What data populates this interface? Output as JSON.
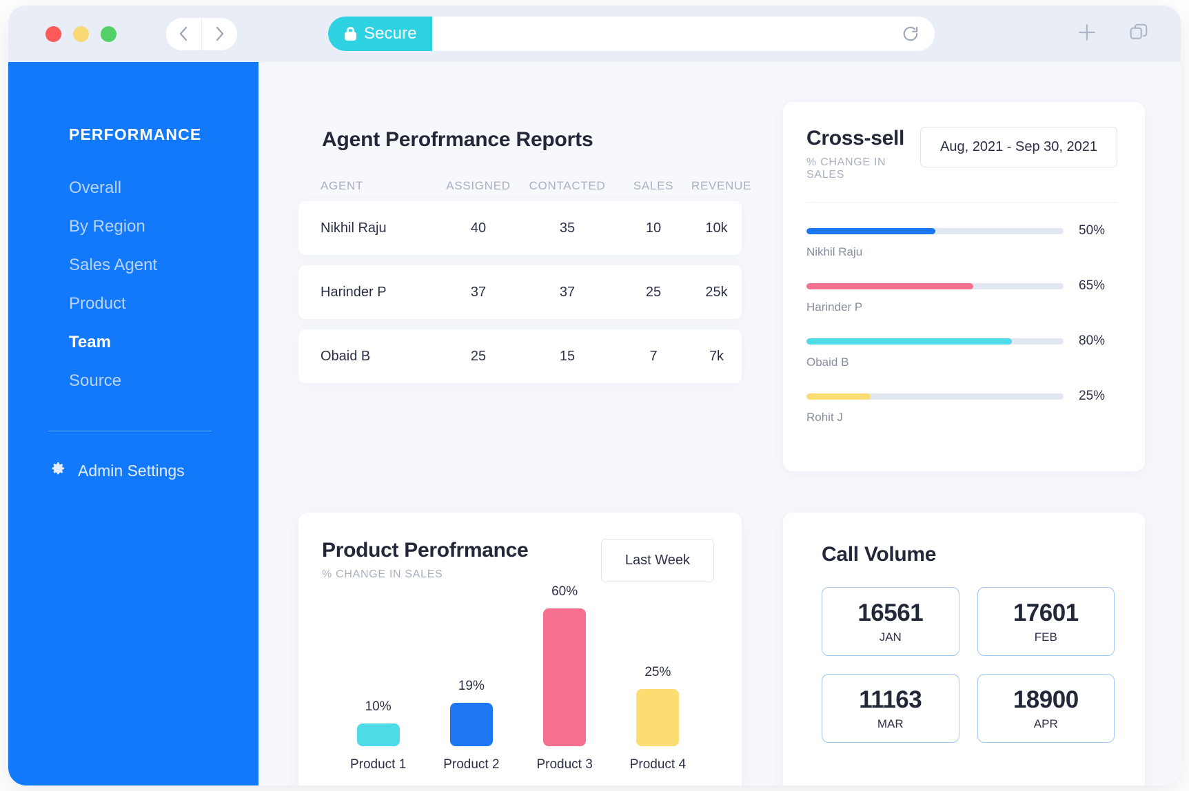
{
  "browser": {
    "secure_label": "Secure",
    "url_value": "",
    "url_placeholder": "",
    "back_icon": "chevron-left-icon",
    "forward_icon": "chevron-right-icon",
    "reload_icon": "reload-icon",
    "new_tab_icon": "plus-icon",
    "tabs_icon": "copy-tabs-icon"
  },
  "sidebar": {
    "heading": "PERFORMANCE",
    "items": [
      {
        "label": "Overall",
        "active": false
      },
      {
        "label": "By Region",
        "active": false
      },
      {
        "label": "Sales Agent",
        "active": false
      },
      {
        "label": "Product",
        "active": false
      },
      {
        "label": "Team",
        "active": true
      },
      {
        "label": "Source",
        "active": false
      }
    ],
    "admin": {
      "label": "Admin Settings",
      "icon": "gear-icon"
    },
    "bg_color": "#1379fb"
  },
  "reports": {
    "title": "Agent Perofrmance Reports",
    "columns": [
      "AGENT",
      "ASSIGNED",
      "CONTACTED",
      "SALES",
      "REVENUE"
    ],
    "rows": [
      {
        "agent": "Nikhil Raju",
        "assigned": "40",
        "contacted": "35",
        "sales": "10",
        "revenue": "10k"
      },
      {
        "agent": "Harinder P",
        "assigned": "37",
        "contacted": "37",
        "sales": "25",
        "revenue": "25k"
      },
      {
        "agent": "Obaid B",
        "assigned": "25",
        "contacted": "15",
        "sales": "7",
        "revenue": "7k"
      }
    ]
  },
  "cross_sell": {
    "title": "Cross-sell",
    "subtitle": "% CHANGE IN SALES",
    "date_range": "Aug, 2021 - Sep 30, 2021",
    "bars": [
      {
        "name": "Nikhil Raju",
        "pct_label": "50%",
        "value": 50,
        "color": "#1d77f2"
      },
      {
        "name": "Harinder P",
        "pct_label": "65%",
        "value": 65,
        "color": "#f5708f"
      },
      {
        "name": "Obaid B",
        "pct_label": "80%",
        "value": 80,
        "color": "#4ddbe8"
      },
      {
        "name": "Rohit J",
        "pct_label": "25%",
        "value": 25,
        "color": "#fbdd72"
      }
    ]
  },
  "product_performance": {
    "title": "Product Perofrmance",
    "subtitle": "% CHANGE IN SALES",
    "range_button": "Last Week"
  },
  "call_volume": {
    "title": "Call Volume",
    "cells": [
      {
        "value": "16561",
        "month": "JAN"
      },
      {
        "value": "17601",
        "month": "FEB"
      },
      {
        "value": "11163",
        "month": "MAR"
      },
      {
        "value": "18900",
        "month": "APR"
      }
    ]
  },
  "chart_data": {
    "type": "bar",
    "title": "Product Perofrmance",
    "subtitle": "% CHANGE IN SALES",
    "categories": [
      "Product 1",
      "Product 2",
      "Product 3",
      "Product 4"
    ],
    "values": [
      10,
      19,
      60,
      25
    ],
    "value_labels": [
      "10%",
      "19%",
      "60%",
      "25%"
    ],
    "colors": [
      "#4ddbe8",
      "#1d77f2",
      "#f5708f",
      "#fbdd72"
    ],
    "xlabel": "",
    "ylabel": "% change in sales",
    "ylim": [
      0,
      60
    ],
    "grid": false,
    "legend": "none"
  }
}
